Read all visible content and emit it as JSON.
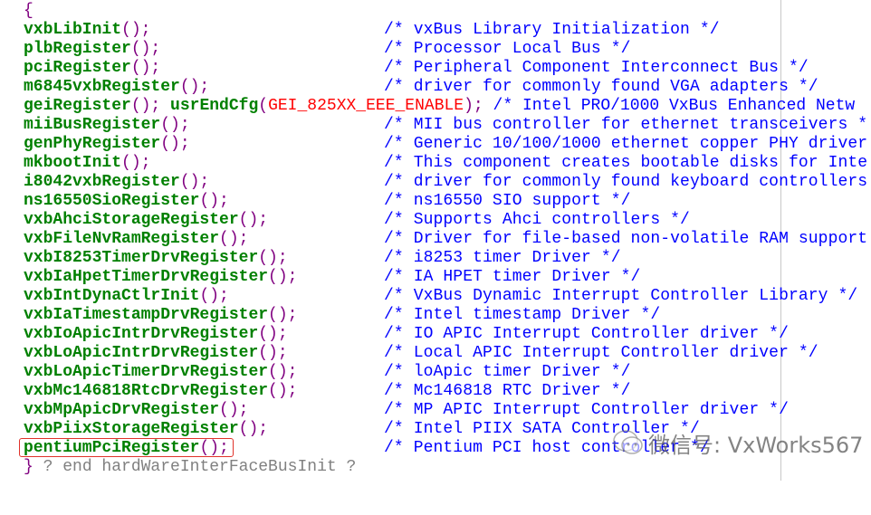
{
  "editor": {
    "open_brace": "{",
    "lines": [
      {
        "fn": "vxbLibInit",
        "args": "();",
        "comment": "/* vxBus Library Initialization */"
      },
      {
        "fn": "plbRegister",
        "args": "();",
        "comment": "/* Processor Local Bus */"
      },
      {
        "fn": "pciRegister",
        "args": "();",
        "comment": "/* Peripheral Component Interconnect Bus */"
      },
      {
        "fn": "m6845vxbRegister",
        "args": "();",
        "comment": "/* driver for commonly found VGA adapters */"
      },
      {
        "fn": "geiRegister",
        "args": "();",
        "fn2": " usrEndCfg",
        "open": "(",
        "macro": "GEI_825XX_EEE_ENABLE",
        "close": ");",
        "comment": " /* Intel PRO/1000 VxBus Enhanced Netw"
      },
      {
        "fn": "miiBusRegister",
        "args": "();",
        "comment": "/* MII bus controller for ethernet transceivers *"
      },
      {
        "fn": "genPhyRegister",
        "args": "();",
        "comment": "/* Generic 10/100/1000 ethernet copper PHY driver"
      },
      {
        "fn": "mkbootInit",
        "args": "();",
        "comment": "/* This component creates bootable disks for Inte"
      },
      {
        "fn": "i8042vxbRegister",
        "args": "();",
        "comment": "/* driver for commonly found keyboard controllers"
      },
      {
        "fn": "ns16550SioRegister",
        "args": "();",
        "comment": "/* ns16550 SIO support */"
      },
      {
        "fn": "vxbAhciStorageRegister",
        "args": "();",
        "comment": "/* Supports Ahci controllers */"
      },
      {
        "fn": "vxbFileNvRamRegister",
        "args": "();",
        "comment": "/* Driver for file-based non-volatile RAM support"
      },
      {
        "fn": "vxbI8253TimerDrvRegister",
        "args": "();",
        "comment": "/* i8253 timer Driver */"
      },
      {
        "fn": "vxbIaHpetTimerDrvRegister",
        "args": "();",
        "comment": "/* IA HPET timer Driver */"
      },
      {
        "fn": "vxbIntDynaCtlrInit",
        "args": "();",
        "comment": "/* VxBus Dynamic Interrupt Controller Library */"
      },
      {
        "fn": "vxbIaTimestampDrvRegister",
        "args": "();",
        "comment": "/* Intel timestamp Driver */"
      },
      {
        "fn": "vxbIoApicIntrDrvRegister",
        "args": "();",
        "comment": "/* IO APIC Interrupt Controller driver */"
      },
      {
        "fn": "vxbLoApicIntrDrvRegister",
        "args": "();",
        "comment": "/* Local APIC Interrupt Controller driver */"
      },
      {
        "fn": "vxbLoApicTimerDrvRegister",
        "args": "();",
        "comment": "/* loApic timer Driver */"
      },
      {
        "fn": "vxbMc146818RtcDrvRegister",
        "args": "();",
        "comment": "/* Mc146818 RTC Driver */"
      },
      {
        "fn": "vxbMpApicDrvRegister",
        "args": "();",
        "comment": "/* MP APIC Interrupt Controller driver */"
      },
      {
        "fn": "vxbPiixStorageRegister",
        "args": "();",
        "comment": "/* Intel PIIX SATA Controller */"
      },
      {
        "fn": "pentiumPciRegister",
        "args": "();",
        "comment": "/* Pentium PCI host controller */",
        "highlighted": true
      }
    ],
    "close_brace": "}",
    "end_note": " ? end hardWareInterFaceBusInit ?"
  },
  "watermark": {
    "label": "微信号: VxWorks567",
    "icon": "wechat-icon"
  },
  "colors": {
    "function": "#008000",
    "punctuation": "#800080",
    "macro": "#ff0000",
    "comment": "#0000ff",
    "end_note": "#808080",
    "highlight_border": "#e0322a"
  }
}
